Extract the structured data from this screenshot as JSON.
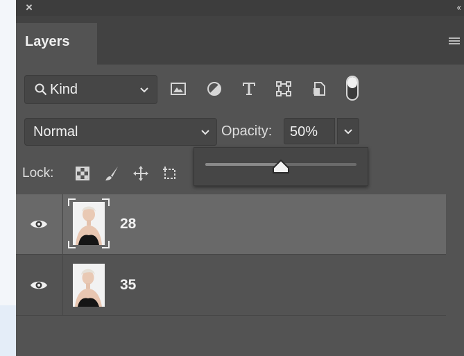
{
  "panel": {
    "title_tab": "Layers"
  },
  "filter": {
    "kind_label": "Kind",
    "filter_icons": [
      "image-filter-icon",
      "adjustment-filter-icon",
      "type-filter-icon",
      "shape-filter-icon",
      "smart-object-filter-icon"
    ],
    "filter_toggle": "filter-on-off-toggle"
  },
  "blend": {
    "mode": "Normal",
    "opacity_label": "Opacity:",
    "opacity_value": "50%",
    "opacity_percent": 50
  },
  "lock": {
    "label": "Lock:",
    "icons": [
      "lock-transparent-pixels-icon",
      "lock-image-pixels-icon",
      "lock-position-icon",
      "lock-artboard-icon"
    ]
  },
  "layers": [
    {
      "name": "28",
      "visible": true,
      "selected": true
    },
    {
      "name": "35",
      "visible": true,
      "selected": false
    }
  ],
  "colors": {
    "panel_bg": "#535353",
    "selected_row": "#696969",
    "tab_bar": "#424242"
  }
}
